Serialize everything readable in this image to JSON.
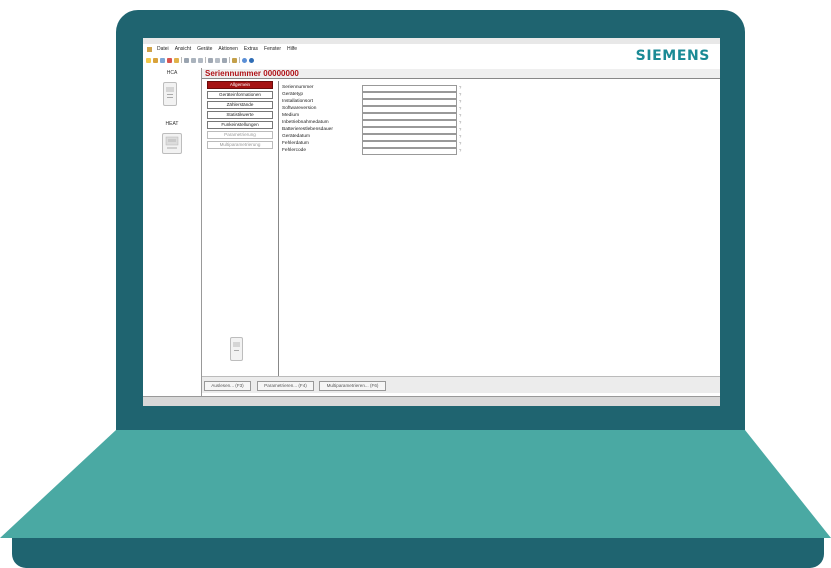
{
  "brand": "SIEMENS",
  "menu": [
    "Datei",
    "Ansicht",
    "Geräte",
    "Aktionen",
    "Extras",
    "Fenster",
    "Hilfe"
  ],
  "toolbar_icons": [
    "new-icon",
    "open-icon",
    "save-icon",
    "delete-icon",
    "refresh-icon",
    "print-icon",
    "print-preview-icon",
    "settings-icon",
    "list-icon",
    "grid-icon",
    "export-icon",
    "help-icon",
    "info-icon"
  ],
  "nav": {
    "hca_label": "HCA",
    "heat_label": "HEAT"
  },
  "title": "Seriennummer  00000000",
  "side_buttons": [
    {
      "label": "Allgemein",
      "state": "active"
    },
    {
      "label": "Geräteinformationen",
      "state": "normal"
    },
    {
      "label": "Zählerstände",
      "state": "normal"
    },
    {
      "label": "Statistikwerte",
      "state": "normal"
    },
    {
      "label": "Funkeinstellungen",
      "state": "normal"
    },
    {
      "label": "Parametrierung",
      "state": "disabled"
    },
    {
      "label": "Multiparametrierung",
      "state": "disabled"
    }
  ],
  "fields": [
    {
      "label": "Seriennummer",
      "value": "",
      "hint": "?"
    },
    {
      "label": "Gerätetyp",
      "value": "",
      "hint": "?"
    },
    {
      "label": "Installationsort",
      "value": "",
      "hint": "?"
    },
    {
      "label": "Softwareversion",
      "value": "",
      "hint": "?"
    },
    {
      "label": "Medium",
      "value": "",
      "hint": "?"
    },
    {
      "label": "Inbetriebnahmedatum",
      "value": "",
      "hint": "?"
    },
    {
      "label": "Batterierestlebensdauer",
      "value": "",
      "hint": "?"
    },
    {
      "label": "Gerätedatum",
      "value": "",
      "hint": "?"
    },
    {
      "label": "Fehlerdatum",
      "value": "",
      "hint": "?"
    },
    {
      "label": "Fehlercode",
      "value": "",
      "hint": "?"
    }
  ],
  "bottom_buttons": {
    "read": "Auslesen... (F3)",
    "param": "Parametrieren... (F4)",
    "multi": "Multiparametrieren... (F6)"
  },
  "colors": {
    "laptop": "#1f6470",
    "laptop_base": "#4aa9a3",
    "brand": "#1a8a95",
    "title": "#b01217",
    "active_tab": "#a51313"
  }
}
